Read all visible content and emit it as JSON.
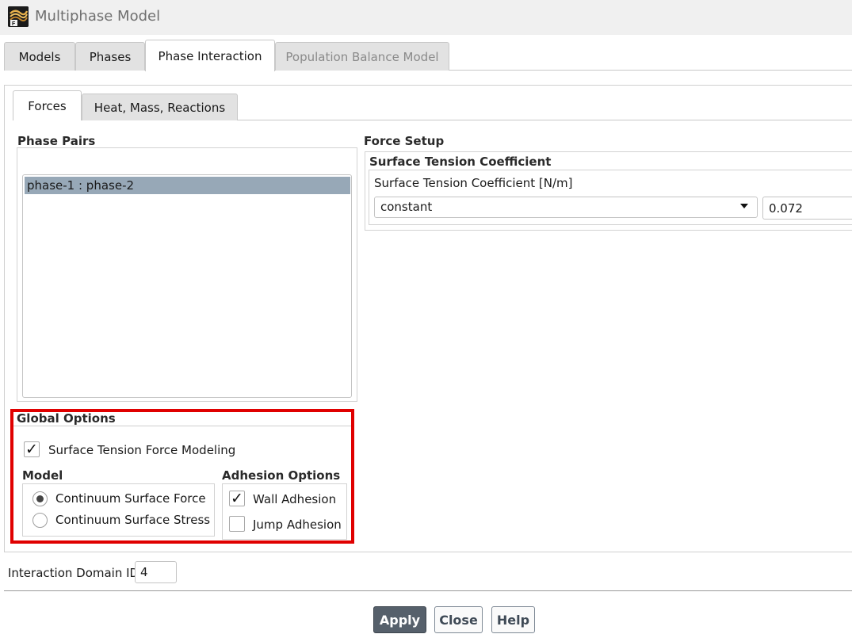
{
  "window": {
    "title": "Multiphase Model",
    "icon": "fluent-logo-icon"
  },
  "tabs": [
    {
      "label": "Models",
      "state": "normal"
    },
    {
      "label": "Phases",
      "state": "normal"
    },
    {
      "label": "Phase Interaction",
      "state": "active"
    },
    {
      "label": "Population Balance Model",
      "state": "disabled"
    }
  ],
  "subtabs": [
    {
      "label": "Forces",
      "state": "active"
    },
    {
      "label": "Heat, Mass, Reactions",
      "state": "normal"
    }
  ],
  "phase_pairs": {
    "title": "Phase Pairs",
    "items": [
      {
        "label": "phase-1 : phase-2",
        "selected": true
      }
    ]
  },
  "force_setup": {
    "title": "Force Setup",
    "surface_tension": {
      "title": "Surface Tension Coefficient",
      "field_label": "Surface Tension Coefficient [N/m]",
      "method": "constant",
      "value": "0.072"
    }
  },
  "global_options": {
    "title": "Global Options",
    "surface_tension_modeling": {
      "label": "Surface Tension Force Modeling",
      "checked": true
    },
    "model": {
      "title": "Model",
      "options": [
        {
          "label": "Continuum Surface Force",
          "selected": true
        },
        {
          "label": "Continuum Surface Stress",
          "selected": false
        }
      ]
    },
    "adhesion": {
      "title": "Adhesion Options",
      "options": [
        {
          "label": "Wall Adhesion",
          "checked": true
        },
        {
          "label": "Jump Adhesion",
          "checked": false
        }
      ]
    }
  },
  "interaction_domain": {
    "label": "Interaction Domain ID",
    "value": "4"
  },
  "buttons": {
    "apply": "Apply",
    "close": "Close",
    "help": "Help"
  },
  "glyphs": {
    "check": "✓"
  },
  "colors": {
    "highlight": "#e00000",
    "selection": "#97a8b7",
    "primary_button": "#56606b"
  }
}
